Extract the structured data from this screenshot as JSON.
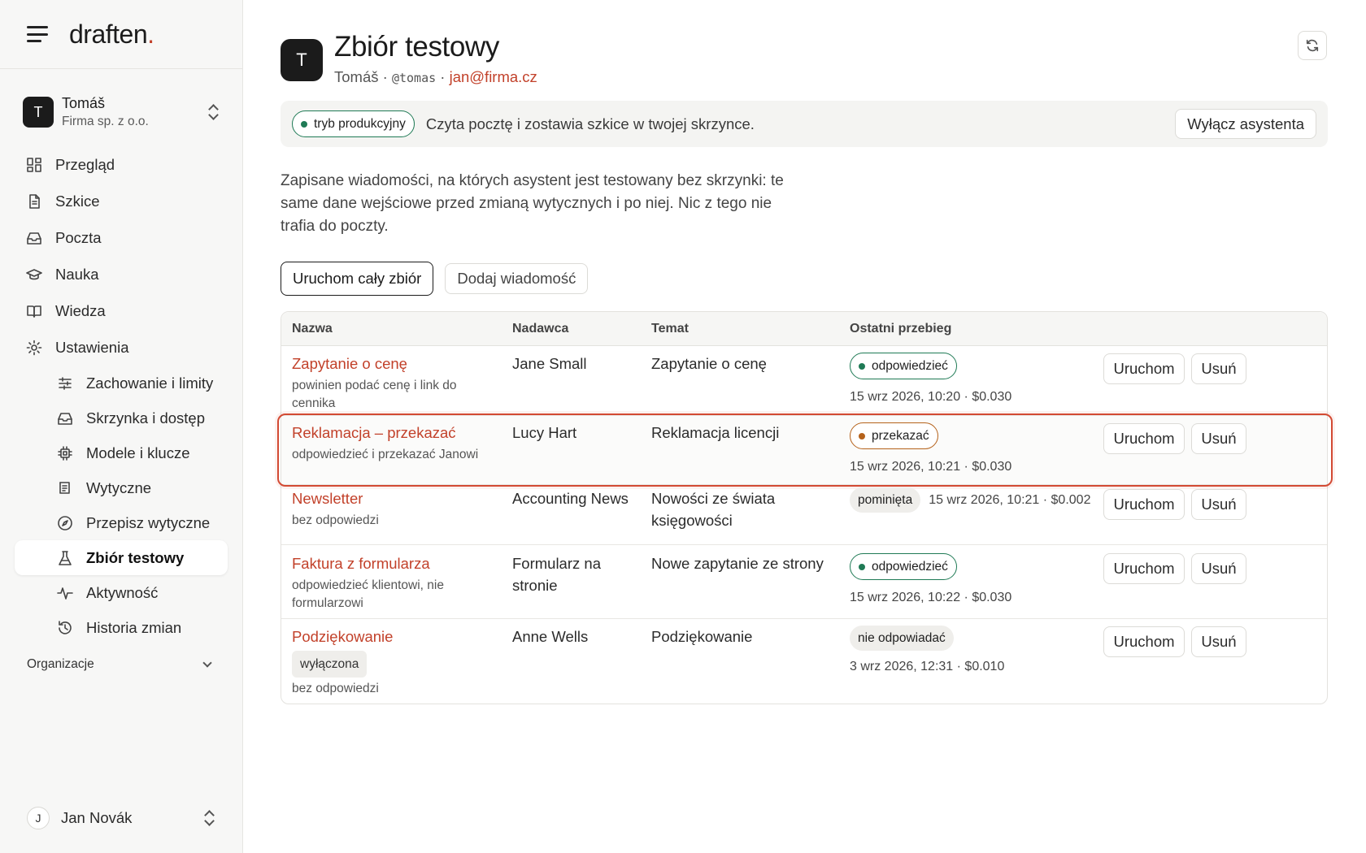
{
  "brand": {
    "logo_text": "draften",
    "logo_dot": "."
  },
  "account": {
    "initial": "T",
    "name": "Tomáš",
    "org": "Firma sp. z o.o."
  },
  "nav": {
    "items": [
      {
        "label": "Przegląd",
        "icon": "dashboard-icon"
      },
      {
        "label": "Szkice",
        "icon": "document-icon"
      },
      {
        "label": "Poczta",
        "icon": "inbox-icon"
      },
      {
        "label": "Nauka",
        "icon": "graduation-cap-icon"
      },
      {
        "label": "Wiedza",
        "icon": "book-icon"
      },
      {
        "label": "Ustawienia",
        "icon": "gear-icon"
      }
    ],
    "sub_items": [
      {
        "label": "Zachowanie i limity",
        "icon": "sliders-icon"
      },
      {
        "label": "Skrzynka i dostęp",
        "icon": "inbox-icon"
      },
      {
        "label": "Modele i klucze",
        "icon": "chip-icon"
      },
      {
        "label": "Wytyczne",
        "icon": "scroll-icon"
      },
      {
        "label": "Przepisz wytyczne",
        "icon": "compass-icon"
      },
      {
        "label": "Zbiór testowy",
        "icon": "flask-icon",
        "active": true
      },
      {
        "label": "Aktywność",
        "icon": "activity-icon"
      },
      {
        "label": "Historia zmian",
        "icon": "history-icon"
      }
    ],
    "org_section": "Organizacje"
  },
  "user": {
    "initial": "J",
    "name": "Jan Novák"
  },
  "header": {
    "avatar_initial": "T",
    "title": "Zbiór testowy",
    "name": "Tomáš",
    "sep1": " · ",
    "handle": "@tomas",
    "sep2": " · ",
    "email": "jan@firma.cz"
  },
  "mode_bar": {
    "badge": "tryb produkcyjny",
    "text": "Czyta pocztę i zostawia szkice w twojej skrzynce.",
    "button": "Wyłącz asystenta"
  },
  "description": "Zapisane wiadomości, na których asystent jest testowany bez skrzynki: te same dane wejściowe przed zmianą wytycznych i po niej. Nic z tego nie trafia do poczty.",
  "actions": {
    "run_all": "Uruchom cały zbiór",
    "add": "Dodaj wiadomość"
  },
  "table": {
    "columns": [
      "Nazwa",
      "Nadawca",
      "Temat",
      "Ostatni przebieg"
    ],
    "run_label": "Uruchom",
    "delete_label": "Usuń",
    "rows": [
      {
        "name": "Zapytanie o cenę",
        "note": "powinien podać cenę i link do cennika",
        "tag": "",
        "sender": "Jane Small",
        "subject": "Zapytanie o cenę",
        "status": "odpowiedzieć",
        "status_type": "green",
        "meta": "15 wrz 2026, 10:20 · $0.030"
      },
      {
        "name": "Reklamacja – przekazać",
        "note": "odpowiedzieć i przekazać Janowi",
        "tag": "",
        "sender": "Lucy Hart",
        "subject": "Reklamacja licencji",
        "status": "przekazać",
        "status_type": "amber",
        "meta": "15 wrz 2026, 10:21 · $0.030"
      },
      {
        "name": "Newsletter",
        "note": "bez odpowiedzi",
        "tag": "",
        "sender": "Accounting News",
        "subject": "Nowości ze świata księgowości",
        "status": "pominięta",
        "status_type": "gray",
        "meta": "15 wrz 2026, 10:21 · $0.002"
      },
      {
        "name": "Faktura z formularza",
        "note": "odpowiedzieć klientowi, nie formularzowi",
        "tag": "",
        "sender": "Formularz na stronie",
        "subject": "Nowe zapytanie ze strony",
        "status": "odpowiedzieć",
        "status_type": "green",
        "meta": "15 wrz 2026, 10:22 · $0.030"
      },
      {
        "name": "Podziękowanie",
        "note": "bez odpowiedzi",
        "tag": "wyłączona",
        "sender": "Anne Wells",
        "subject": "Podziękowanie",
        "status": "nie odpowiadać",
        "status_type": "gray",
        "meta": "3 wrz 2026, 12:31 · $0.010"
      }
    ]
  },
  "colors": {
    "accent": "#c2412a",
    "green": "#1f7a55",
    "amber": "#b5621b",
    "highlight": "#d34a33"
  }
}
